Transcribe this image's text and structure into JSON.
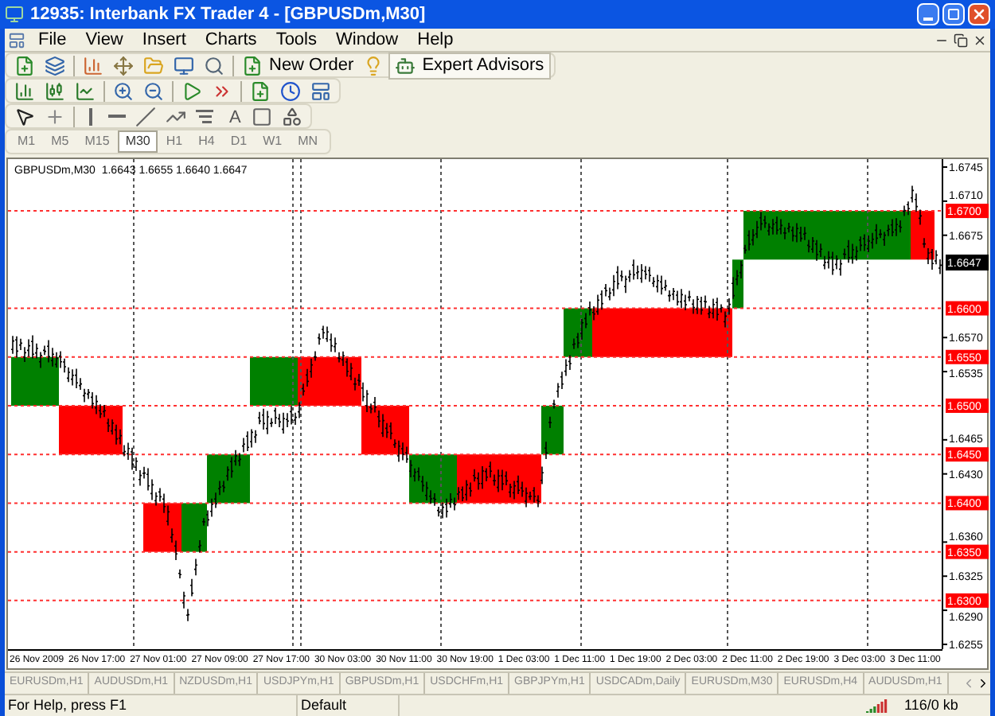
{
  "window": {
    "title": "12935: Interbank FX Trader 4 - [GBPUSDm,M30]"
  },
  "menu": [
    "File",
    "View",
    "Insert",
    "Charts",
    "Tools",
    "Window",
    "Help"
  ],
  "toolbar": {
    "new_order": "New Order",
    "expert_advisors": "Expert Advisors",
    "text_tool": "A"
  },
  "timeframes": [
    {
      "label": "M1",
      "selected": false
    },
    {
      "label": "M5",
      "selected": false
    },
    {
      "label": "M15",
      "selected": false
    },
    {
      "label": "M30",
      "selected": true
    },
    {
      "label": "H1",
      "selected": false
    },
    {
      "label": "H4",
      "selected": false
    },
    {
      "label": "D1",
      "selected": false
    },
    {
      "label": "W1",
      "selected": false
    },
    {
      "label": "MN",
      "selected": false
    }
  ],
  "chart": {
    "header": "GBPUSDm,M30  1.6643 1.6655 1.6640 1.6647",
    "price_labels": [
      "1.6745",
      "1.6710",
      "1.6675",
      "1.6570",
      "1.6535",
      "1.6465",
      "1.6430",
      "1.6360",
      "1.6325",
      "1.6290",
      "1.6255"
    ],
    "level_labels": [
      "1.6700",
      "1.6600",
      "1.6550",
      "1.6500",
      "1.6450",
      "1.6400",
      "1.6350",
      "1.6300"
    ],
    "current_price": "1.6647",
    "time_labels": [
      "26 Nov 2009",
      "26 Nov 17:00",
      "27 Nov 01:00",
      "27 Nov 09:00",
      "27 Nov 17:00",
      "30 Nov 03:00",
      "30 Nov 11:00",
      "30 Nov 19:00",
      "1 Dec 03:00",
      "1 Dec 11:00",
      "1 Dec 19:00",
      "2 Dec 03:00",
      "2 Dec 11:00",
      "2 Dec 19:00",
      "3 Dec 03:00",
      "3 Dec 11:00"
    ]
  },
  "chart_tabs": [
    {
      "label": "EURUSDm,H1",
      "selected": false
    },
    {
      "label": "AUDUSDm,H1",
      "selected": false
    },
    {
      "label": "NZDUSDm,H1",
      "selected": false
    },
    {
      "label": "USDJPYm,H1",
      "selected": false
    },
    {
      "label": "GBPUSDm,H1",
      "selected": false
    },
    {
      "label": "USDCHFm,H1",
      "selected": false
    },
    {
      "label": "GBPJPYm,H1",
      "selected": false
    },
    {
      "label": "USDCADm,Daily",
      "selected": false
    },
    {
      "label": "EURUSDm,M30",
      "selected": false
    },
    {
      "label": "EURUSDm,H4",
      "selected": false
    },
    {
      "label": "AUDUSDm,H1",
      "selected": false
    }
  ],
  "status_bar": {
    "help": "For Help, press F1",
    "profile": "Default",
    "traffic": "116/0 kb"
  }
}
